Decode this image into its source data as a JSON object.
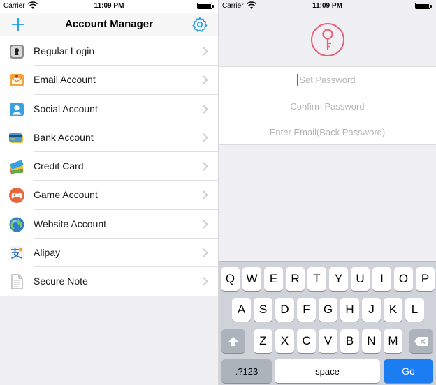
{
  "left_screen": {
    "status": {
      "carrier": "Carrier",
      "time": "11:09 PM"
    },
    "nav": {
      "title": "Account Manager",
      "add_icon": "plus-icon",
      "settings_icon": "gear-icon",
      "accent": "#1e9be8"
    },
    "items": [
      {
        "label": "Regular Login",
        "icon": "keyhole-icon"
      },
      {
        "label": "Email Account",
        "icon": "envelope-icon"
      },
      {
        "label": "Social Account",
        "icon": "person-icon"
      },
      {
        "label": "Bank Account",
        "icon": "bank-card-icon"
      },
      {
        "label": "Credit Card",
        "icon": "credit-cards-icon"
      },
      {
        "label": "Game Account",
        "icon": "gamepad-icon"
      },
      {
        "label": "Website Account",
        "icon": "globe-icon"
      },
      {
        "label": "Alipay",
        "icon": "alipay-icon"
      },
      {
        "label": "Secure Note",
        "icon": "note-icon"
      }
    ]
  },
  "right_screen": {
    "status": {
      "carrier": "Carrier",
      "time": "11:09 PM"
    },
    "logo_icon": "key-icon",
    "logo_color": "#e8607a",
    "fields": {
      "set_password": "Set Password",
      "confirm_password": "Confirm Password",
      "email": "Enter Email(Back Password)"
    },
    "keyboard": {
      "row1": [
        "Q",
        "W",
        "E",
        "R",
        "T",
        "Y",
        "U",
        "I",
        "O",
        "P"
      ],
      "row2": [
        "A",
        "S",
        "D",
        "F",
        "G",
        "H",
        "J",
        "K",
        "L"
      ],
      "row3": [
        "Z",
        "X",
        "C",
        "V",
        "B",
        "N",
        "M"
      ],
      "numbers_key": ".?123",
      "space_key": "space",
      "go_key": "Go",
      "go_color": "#1a7ef2"
    }
  }
}
